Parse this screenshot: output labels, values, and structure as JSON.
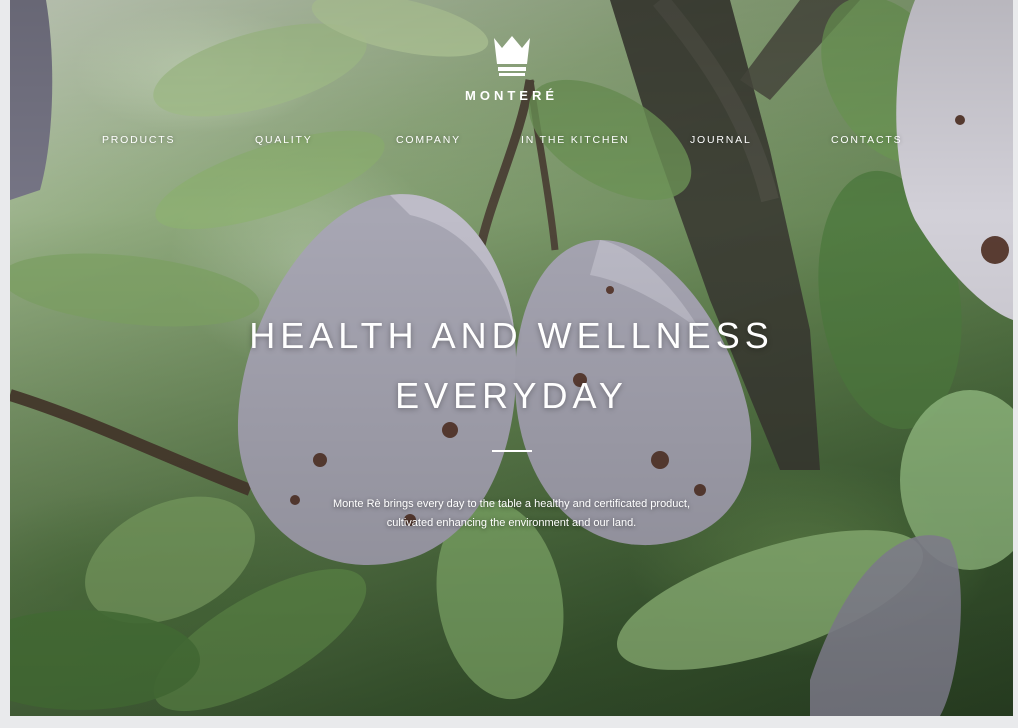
{
  "brand": {
    "name": "MONTERÉ"
  },
  "nav": {
    "items": [
      {
        "label": "PRODUCTS"
      },
      {
        "label": "QUALITY"
      },
      {
        "label": "COMPANY"
      },
      {
        "label": "IN THE KITCHEN"
      },
      {
        "label": "JOURNAL"
      },
      {
        "label": "CONTACTS"
      }
    ]
  },
  "hero": {
    "headline_line1": "HEALTH AND WELLNESS",
    "headline_line2": "EVERYDAY",
    "subtitle_line1": "Monte Rè brings every day to the table a healthy and certificated product,",
    "subtitle_line2": "cultivated enhancing the environment and our land."
  },
  "colors": {
    "text": "#ffffff",
    "leaf": "#5d7d4c",
    "plum": "#9a99a6"
  },
  "icons": {
    "logo": "crown-icon"
  }
}
